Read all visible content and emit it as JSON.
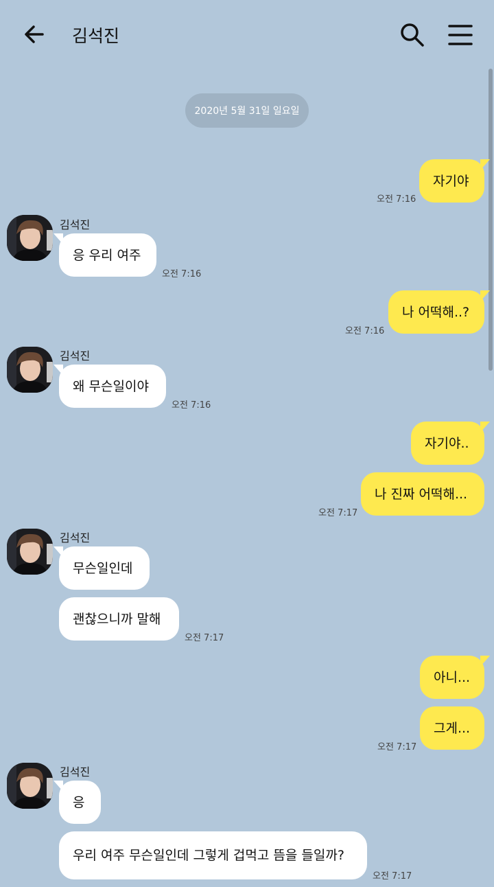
{
  "header": {
    "title": "김석진",
    "back_icon": "arrow-left-icon",
    "search_icon": "search-icon",
    "menu_icon": "hamburger-menu-icon"
  },
  "date_separator": "2020년 5월 31일 일요일",
  "sender_name": "김석진",
  "messages": [
    {
      "from": "me",
      "text": "자기야",
      "time": "오전 7:16"
    },
    {
      "from": "other",
      "text": "응 우리 여주",
      "time": "오전 7:16"
    },
    {
      "from": "me",
      "text": "나 어떡해..?",
      "time": "오전 7:16"
    },
    {
      "from": "other",
      "text": "왜 무슨일이야",
      "time": "오전 7:16"
    },
    {
      "from": "me",
      "text": "자기야.."
    },
    {
      "from": "me",
      "text": "나 진짜 어떡해...",
      "time": "오전 7:17"
    },
    {
      "from": "other",
      "text": "무슨일인데"
    },
    {
      "from": "other",
      "text": "괜찮으니까 말해",
      "time": "오전 7:17"
    },
    {
      "from": "me",
      "text": "아니..."
    },
    {
      "from": "me",
      "text": "그게...",
      "time": "오전 7:17"
    },
    {
      "from": "other",
      "text": "응"
    },
    {
      "from": "other",
      "text": "우리 여주 무슨일인데 그렇게 겁먹고 뜸을 들일까?",
      "time": "오전 7:17"
    }
  ],
  "colors": {
    "background": "#b2c7da",
    "my_bubble": "#fee94f",
    "other_bubble": "#ffffff"
  }
}
